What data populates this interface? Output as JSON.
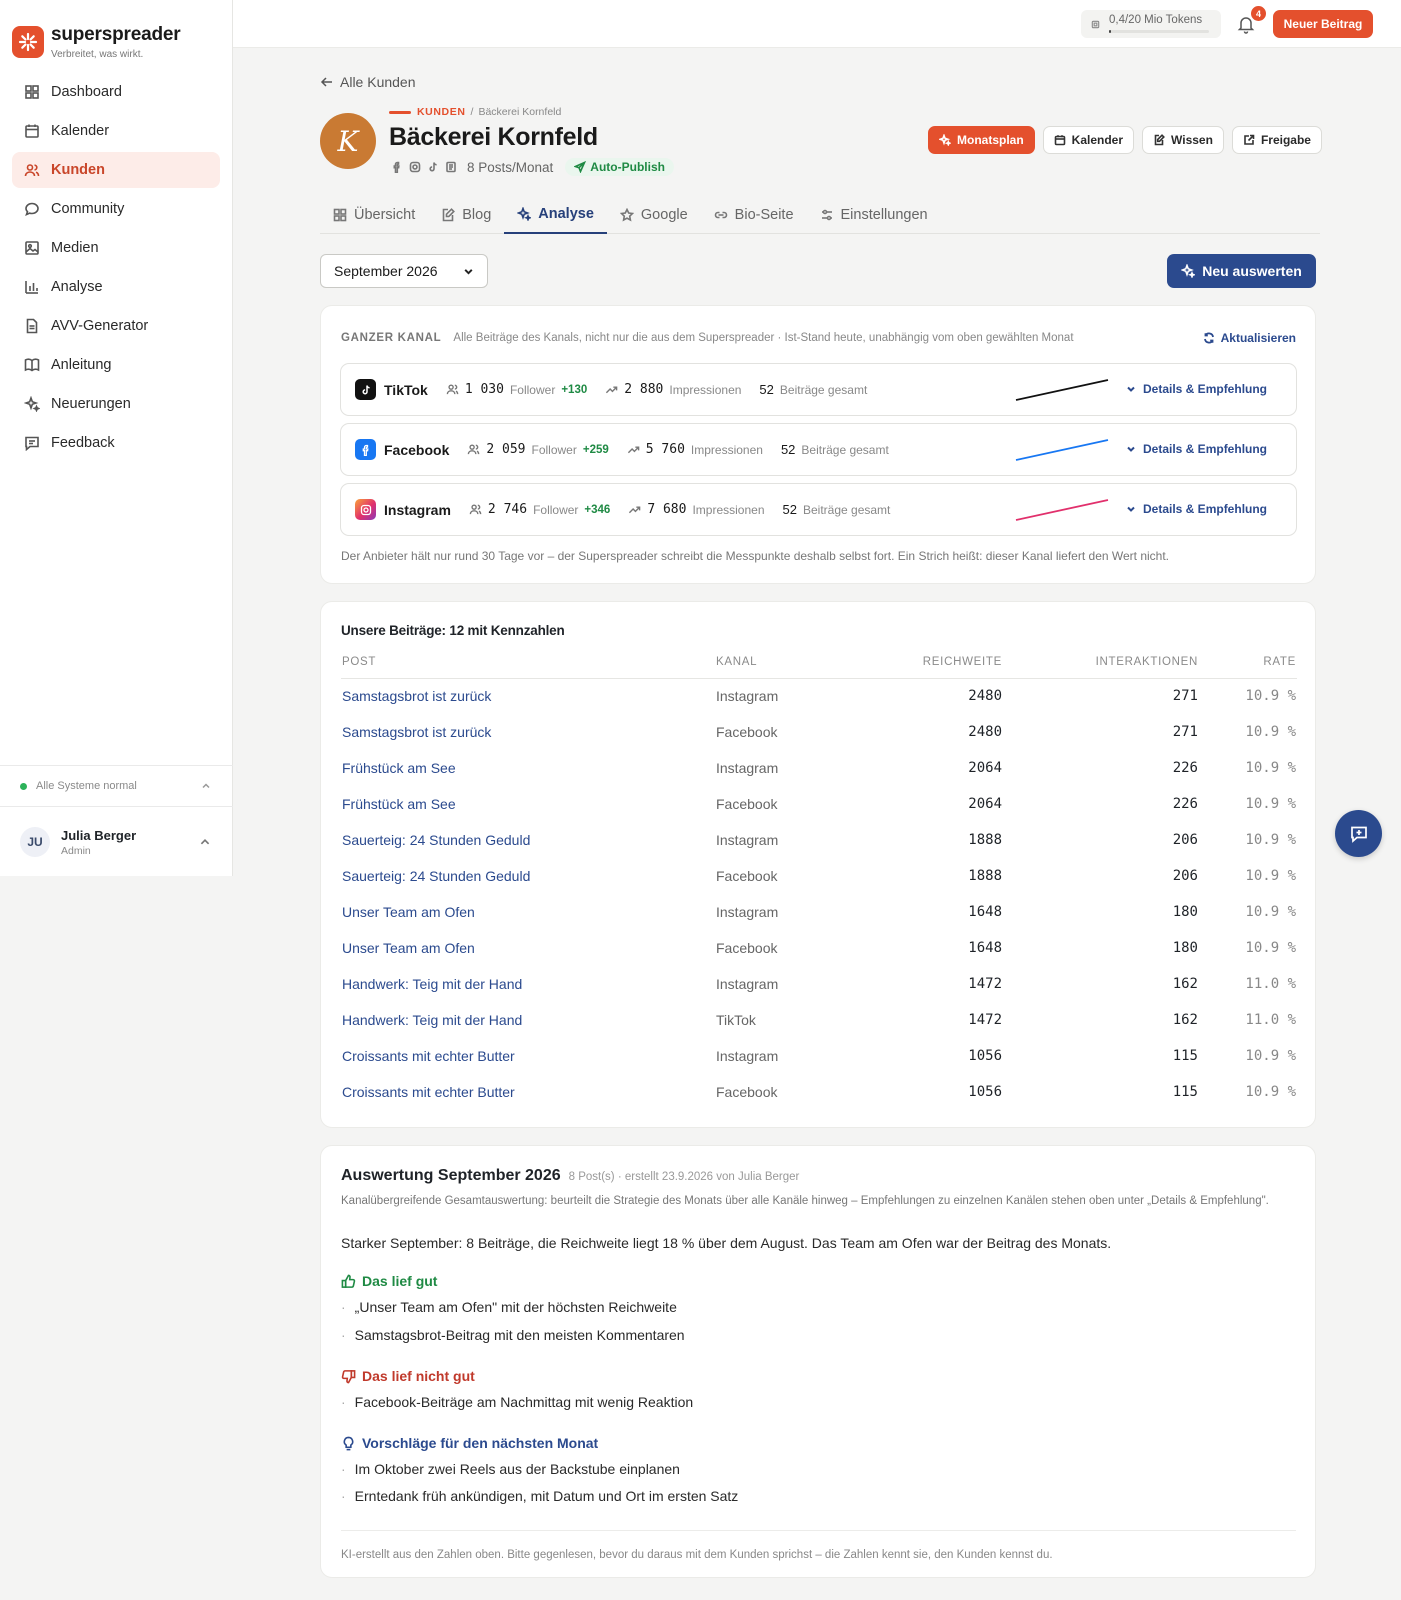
{
  "brand": {
    "name": "superspreader",
    "tagline": "Verbreitet, was wirkt."
  },
  "sidebar": {
    "items": [
      {
        "label": "Dashboard",
        "icon": "grid-icon"
      },
      {
        "label": "Kalender",
        "icon": "calendar-icon"
      },
      {
        "label": "Kunden",
        "icon": "users-icon",
        "active": true
      },
      {
        "label": "Community",
        "icon": "chat-icon"
      },
      {
        "label": "Medien",
        "icon": "image-icon"
      },
      {
        "label": "Analyse",
        "icon": "bar-chart-icon"
      },
      {
        "label": "AVV-Generator",
        "icon": "document-icon"
      },
      {
        "label": "Anleitung",
        "icon": "book-icon"
      },
      {
        "label": "Neuerungen",
        "icon": "sparkle-icon"
      },
      {
        "label": "Feedback",
        "icon": "message-icon"
      }
    ],
    "status": "Alle Systeme normal",
    "user": {
      "initials": "JU",
      "name": "Julia Berger",
      "role": "Admin"
    }
  },
  "topbar": {
    "tokens": "0,4/20 Mio Tokens",
    "token_progress": 0.02,
    "notifications": "4",
    "new_post": "Neuer Beitrag"
  },
  "header": {
    "back": "Alle Kunden",
    "avatar_letter": "K",
    "crumb_section": "KUNDEN",
    "crumb_current": "Bäckerei Kornfeld",
    "title": "Bäckerei Kornfeld",
    "posts_per_month": "8 Posts/Monat",
    "auto_publish": "Auto-Publish",
    "buttons": {
      "monatsplan": "Monatsplan",
      "kalender": "Kalender",
      "wissen": "Wissen",
      "freigabe": "Freigabe"
    }
  },
  "tabs": [
    "Übersicht",
    "Blog",
    "Analyse",
    "Google",
    "Bio-Seite",
    "Einstellungen"
  ],
  "controls": {
    "month": "September 2026",
    "evaluate": "Neu auswerten"
  },
  "channels_card": {
    "label": "GANZER KANAL",
    "description": "Alle Beiträge des Kanals, nicht nur die aus dem Superspreader · Ist-Stand heute, unabhängig vom oben gewählten Monat",
    "refresh": "Aktualisieren",
    "follower_label": "Follower",
    "impressions_label": "Impressionen",
    "posts_label": "Beiträge gesamt",
    "details_label": "Details & Empfehlung",
    "channels": [
      {
        "name": "TikTok",
        "followers": "1 030",
        "delta": "+130",
        "impressions": "2 880",
        "posts": "52",
        "color": "#111111"
      },
      {
        "name": "Facebook",
        "followers": "2 059",
        "delta": "+259",
        "impressions": "5 760",
        "posts": "52",
        "color": "#1877f2"
      },
      {
        "name": "Instagram",
        "followers": "2 746",
        "delta": "+346",
        "impressions": "7 680",
        "posts": "52",
        "color": "#e1306c"
      }
    ],
    "note": "Der Anbieter hält nur rund 30 Tage vor – der Superspreader schreibt die Messpunkte deshalb selbst fort. Ein Strich heißt: dieser Kanal liefert den Wert nicht."
  },
  "posts_table": {
    "title": "Unsere Beiträge: 12 mit Kennzahlen",
    "headers": [
      "POST",
      "KANAL",
      "REICHWEITE",
      "INTERAKTIONEN",
      "RATE"
    ],
    "rows": [
      [
        "Samstagsbrot ist zurück",
        "Instagram",
        "2480",
        "271",
        "10.9 %"
      ],
      [
        "Samstagsbrot ist zurück",
        "Facebook",
        "2480",
        "271",
        "10.9 %"
      ],
      [
        "Frühstück am See",
        "Instagram",
        "2064",
        "226",
        "10.9 %"
      ],
      [
        "Frühstück am See",
        "Facebook",
        "2064",
        "226",
        "10.9 %"
      ],
      [
        "Sauerteig: 24 Stunden Geduld",
        "Instagram",
        "1888",
        "206",
        "10.9 %"
      ],
      [
        "Sauerteig: 24 Stunden Geduld",
        "Facebook",
        "1888",
        "206",
        "10.9 %"
      ],
      [
        "Unser Team am Ofen",
        "Instagram",
        "1648",
        "180",
        "10.9 %"
      ],
      [
        "Unser Team am Ofen",
        "Facebook",
        "1648",
        "180",
        "10.9 %"
      ],
      [
        "Handwerk: Teig mit der Hand",
        "Instagram",
        "1472",
        "162",
        "11.0 %"
      ],
      [
        "Handwerk: Teig mit der Hand",
        "TikTok",
        "1472",
        "162",
        "11.0 %"
      ],
      [
        "Croissants mit echter Butter",
        "Instagram",
        "1056",
        "115",
        "10.9 %"
      ],
      [
        "Croissants mit echter Butter",
        "Facebook",
        "1056",
        "115",
        "10.9 %"
      ]
    ]
  },
  "evaluation": {
    "title": "Auswertung September 2026",
    "meta": "8 Post(s) · erstellt 23.9.2026 von Julia Berger",
    "description": "Kanalübergreifende Gesamtauswertung: beurteilt die Strategie des Monats über alle Kanäle hinweg – Empfehlungen zu einzelnen Kanälen stehen oben unter „Details & Empfehlung\".",
    "summary": "Starker September: 8 Beiträge, die Reichweite liegt 18 % über dem August. Das Team am Ofen war der Beitrag des Monats.",
    "good_title": "Das lief gut",
    "good": [
      "„Unser Team am Ofen\" mit der höchsten Reichweite",
      "Samstagsbrot-Beitrag mit den meisten Kommentaren"
    ],
    "bad_title": "Das lief nicht gut",
    "bad": [
      "Facebook-Beiträge am Nachmittag mit wenig Reaktion"
    ],
    "tips_title": "Vorschläge für den nächsten Monat",
    "tips": [
      "Im Oktober zwei Reels aus der Backstube einplanen",
      "Erntedank früh ankündigen, mit Datum und Ort im ersten Satz"
    ],
    "footer": "KI-erstellt aus den Zahlen oben. Bitte gegenlesen, bevor du daraus mit dem Kunden sprichst – die Zahlen kennt sie, den Kunden kennst du."
  }
}
